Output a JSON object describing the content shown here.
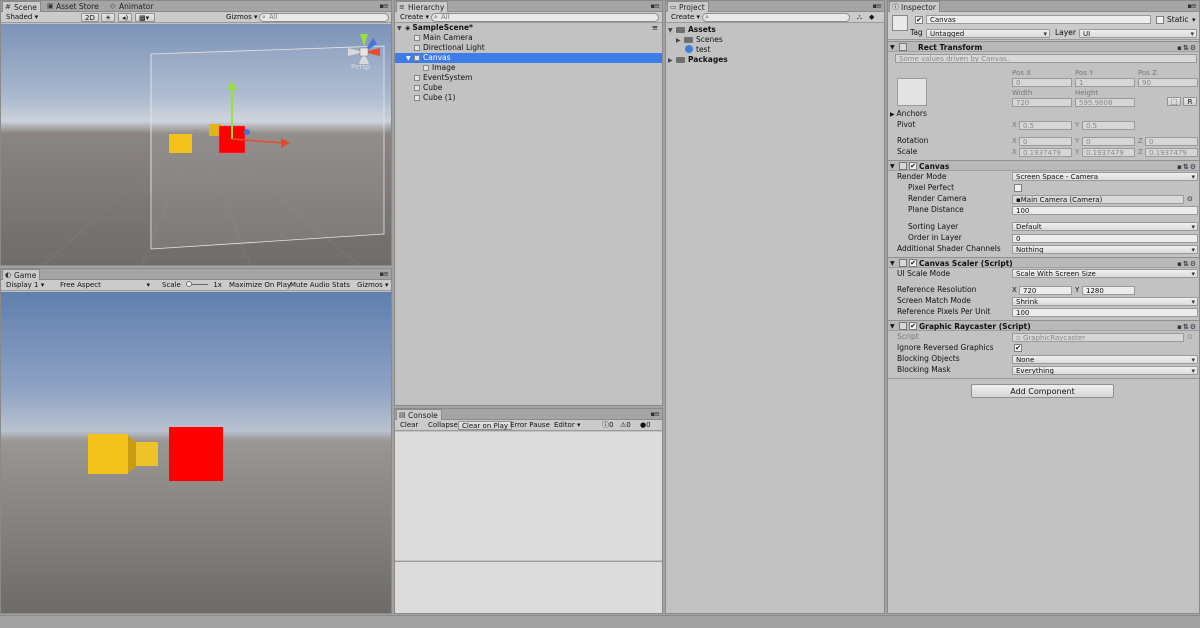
{
  "scene_panel": {
    "tabs": [
      "Scene",
      "Asset Store",
      "Animator"
    ],
    "shading": "Shaded",
    "mode_2d": "2D",
    "gizmos": "Gizmos",
    "search_placeholder": "All",
    "persp": "Persp"
  },
  "game_panel": {
    "tab": "Game",
    "display": "Display 1",
    "aspect": "Free Aspect",
    "scale_label": "Scale",
    "scale_value": "1x",
    "maximize": "Maximize On Play",
    "mute": "Mute Audio",
    "stats": "Stats",
    "gizmos": "Gizmos"
  },
  "hierarchy": {
    "tab": "Hierarchy",
    "create": "Create",
    "search_placeholder": "All",
    "scene_name": "SampleScene*",
    "items": [
      "Main Camera",
      "Directional Light",
      "Canvas",
      "Image",
      "EventSystem",
      "Cube",
      "Cube (1)"
    ],
    "selected": "Canvas"
  },
  "console": {
    "tab": "Console",
    "buttons": [
      "Clear",
      "Collapse",
      "Clear on Play",
      "Error Pause",
      "Editor"
    ],
    "counts": [
      "0",
      "0",
      "0"
    ]
  },
  "project": {
    "tab": "Project",
    "create": "Create",
    "assets": "Assets",
    "scenes": "Scenes",
    "test": "test",
    "packages": "Packages"
  },
  "inspector": {
    "tab": "Inspector",
    "object_name": "Canvas",
    "static_label": "Static",
    "tag_label": "Tag",
    "tag_value": "Untagged",
    "layer_label": "Layer",
    "layer_value": "UI",
    "rect_transform": {
      "title": "Rect Transform",
      "note": "Some values driven by Canvas.",
      "pos_x_label": "Pos X",
      "pos_y_label": "Pos Y",
      "pos_z_label": "Pos Z",
      "pos_x": "0",
      "pos_y": "1",
      "pos_z": "90",
      "width_label": "Width",
      "height_label": "Height",
      "width": "720",
      "height": "595.9808",
      "anchors": "Anchors",
      "pivot": "Pivot",
      "pivot_x": "0.5",
      "pivot_y": "0.5",
      "rotation": "Rotation",
      "rot_x": "0",
      "rot_y": "0",
      "rot_z": "0",
      "scale": "Scale",
      "scale_x": "0.1937479",
      "scale_y": "0.1937479",
      "scale_z": "0.1937479",
      "r_button": "R"
    },
    "canvas": {
      "title": "Canvas",
      "render_mode_label": "Render Mode",
      "render_mode": "Screen Space - Camera",
      "pixel_perfect_label": "Pixel Perfect",
      "render_camera_label": "Render Camera",
      "render_camera": "Main Camera (Camera)",
      "plane_distance_label": "Plane Distance",
      "plane_distance": "100",
      "sorting_layer_label": "Sorting Layer",
      "sorting_layer": "Default",
      "order_label": "Order in Layer",
      "order": "0",
      "shader_channels_label": "Additional Shader Channels",
      "shader_channels": "Nothing"
    },
    "canvas_scaler": {
      "title": "Canvas Scaler (Script)",
      "ui_scale_mode_label": "UI Scale Mode",
      "ui_scale_mode": "Scale With Screen Size",
      "ref_res_label": "Reference Resolution",
      "ref_x": "720",
      "ref_y": "1280",
      "match_mode_label": "Screen Match Mode",
      "match_mode": "Shrink",
      "ppu_label": "Reference Pixels Per Unit",
      "ppu": "100"
    },
    "raycaster": {
      "title": "Graphic Raycaster (Script)",
      "script_label": "Script",
      "script": "GraphicRaycaster",
      "ignore_label": "Ignore Reversed Graphics",
      "blocking_objects_label": "Blocking Objects",
      "blocking_objects": "None",
      "blocking_mask_label": "Blocking Mask",
      "blocking_mask": "Everything"
    },
    "add_component": "Add Component"
  },
  "colors": {
    "selection": "#3e7de7",
    "cube_red": "#ff0000",
    "cube_yellow": "#f2c21b"
  }
}
